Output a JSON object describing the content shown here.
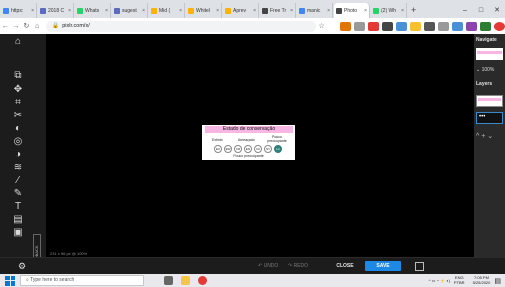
{
  "browser": {
    "tabs": [
      {
        "label": "https:",
        "color": "#4285f4"
      },
      {
        "label": "2018 C",
        "color": "#5c6bc0"
      },
      {
        "label": "Whats",
        "color": "#25d366"
      },
      {
        "label": "sugest",
        "color": "#5c6bc0"
      },
      {
        "label": "Mid (",
        "color": "#ffb300"
      },
      {
        "label": "Whitel",
        "color": "#ffb300"
      },
      {
        "label": "Aprev",
        "color": "#ffb300"
      },
      {
        "label": "Free Tr",
        "color": "#444444"
      },
      {
        "label": "manic",
        "color": "#4285f4"
      },
      {
        "label": "Photo",
        "color": "#444444",
        "active": true
      },
      {
        "label": "(2) Wh",
        "color": "#25d366"
      }
    ],
    "new_tab": "+",
    "address": "pixlr.com/x/"
  },
  "editor": {
    "feedback_label": "FEEDBACK",
    "status": "231 x 96 px @ 100%",
    "artwork": {
      "title": "Estado de conservação",
      "label_left": "Extinto",
      "label_mid": "Ameaçado",
      "label_right": "Pouco preocupante",
      "circles": [
        "EX",
        "EW",
        "CR",
        "EN",
        "VU",
        "NT",
        "LC"
      ],
      "footer": "Pouco preocupante"
    }
  },
  "right_panel": {
    "navigator": "Navigate",
    "zoom": "100%",
    "layers": "Layers",
    "layer_item": "•••",
    "actions": "^ + ⌄"
  },
  "bottom_bar": {
    "undo": "↶ UNDO",
    "redo": "↷ REDO",
    "close": "CLOSE",
    "save": "SAVE"
  },
  "taskbar": {
    "search_placeholder": "Type here to search",
    "lang": "ENG\nPTBR",
    "time": "7:05 PM",
    "date": "5/25/2020"
  }
}
